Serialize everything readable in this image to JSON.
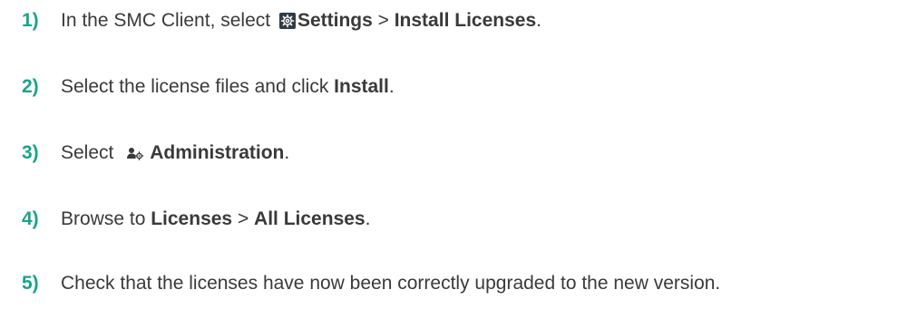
{
  "steps": [
    {
      "number": "1)",
      "pre": "In the SMC Client, select ",
      "icon": "settings-gear-icon",
      "b1": "Settings",
      "mid": " > ",
      "b2": "Install Licenses",
      "post": "."
    },
    {
      "number": "2)",
      "pre": "Select the license files and click ",
      "b1": "Install",
      "post": "."
    },
    {
      "number": "3)",
      "pre": "Select ",
      "icon": "administration-icon",
      "b1": "Administration",
      "post": "."
    },
    {
      "number": "4)",
      "pre": "Browse to ",
      "b1": "Licenses",
      "mid": " > ",
      "b2": "All Licenses",
      "post": "."
    },
    {
      "number": "5)",
      "text": "Check that the licenses have now been correctly upgraded to the new version."
    }
  ],
  "colors": {
    "step_number": "#1aa38a",
    "text": "#3a3a3a",
    "gear_icon_bg": "#2f3b46"
  }
}
